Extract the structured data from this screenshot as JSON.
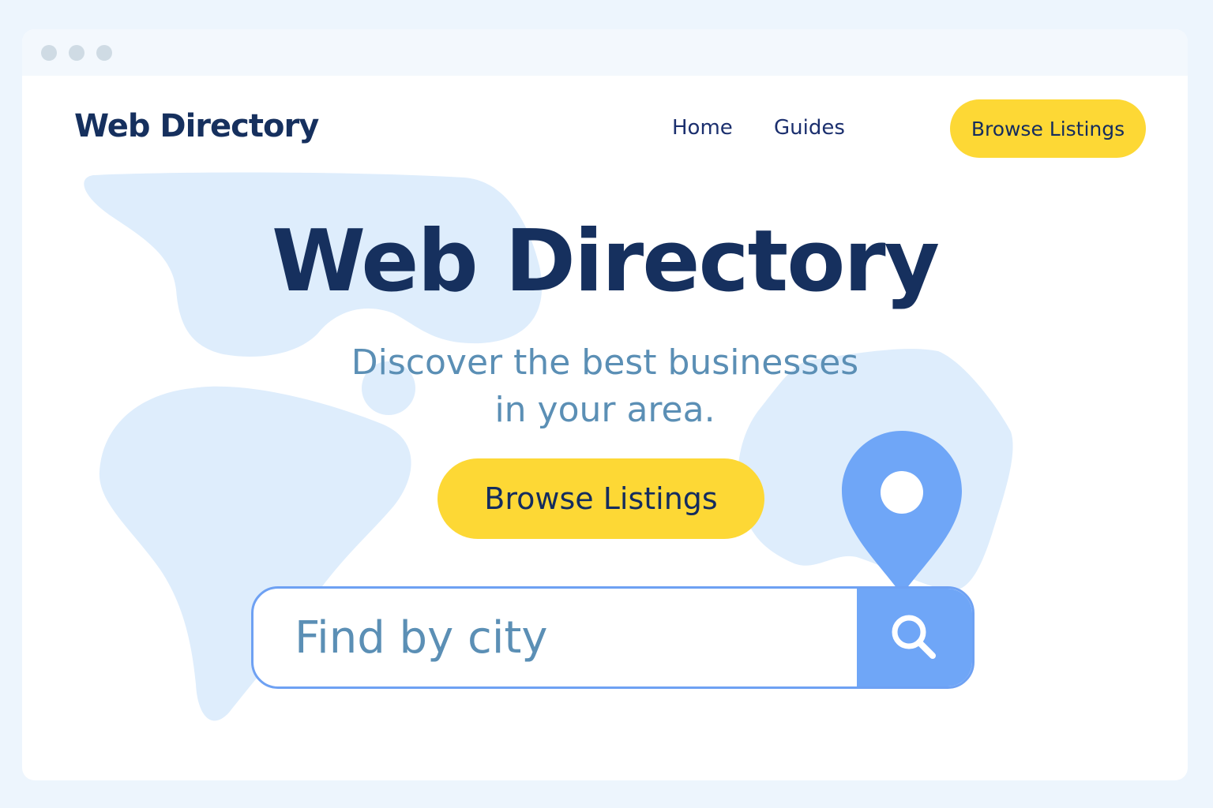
{
  "colors": {
    "page_background": "#edf5fd",
    "accent_yellow": "#fdd835",
    "navy_text": "#16305e",
    "muted_blue_text": "#5b8fb5",
    "pin_blue": "#6fa6f7",
    "map_blue": "#deedfc"
  },
  "window": {
    "controls": [
      "dot",
      "dot",
      "dot"
    ]
  },
  "header": {
    "logo": "Web Directory",
    "nav": [
      {
        "label": "Home"
      },
      {
        "label": "Guides"
      }
    ],
    "cta_label": "Browse Listings"
  },
  "hero": {
    "title": "Web Directory",
    "subtitle_line1": "Discover the best businesses",
    "subtitle_line2": "in your area.",
    "cta_label": "Browse Listings"
  },
  "search": {
    "placeholder": "Find by city",
    "value": "",
    "button_icon": "search-icon"
  },
  "decorations": {
    "background_icon": "world-map-illustration",
    "pin_icon": "location-pin-icon"
  }
}
